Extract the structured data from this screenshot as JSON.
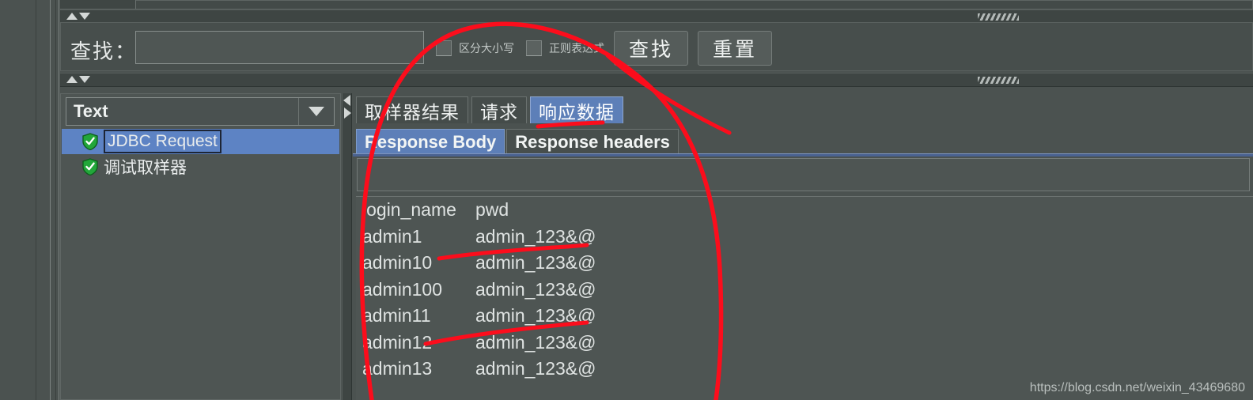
{
  "find_bar": {
    "label": "查找：",
    "input_value": "",
    "input_placeholder": "",
    "checkboxes": [
      {
        "label": "区分大小写",
        "checked": false
      },
      {
        "label": "正则表达式",
        "checked": false
      }
    ],
    "buttons": [
      {
        "label": "查找"
      },
      {
        "label": "重置"
      }
    ]
  },
  "tree_panel": {
    "combo": {
      "selected": "Text",
      "arrow_icon": "chevron-down-icon"
    },
    "items": [
      {
        "label": "JDBC Request",
        "icon": "green-shield-icon",
        "selected": true
      },
      {
        "label": "调试取样器",
        "icon": "green-shield-icon",
        "selected": false
      }
    ]
  },
  "results": {
    "tabs": [
      {
        "label": "取样器结果",
        "active": false
      },
      {
        "label": "请求",
        "active": false
      },
      {
        "label": "响应数据",
        "active": true
      }
    ],
    "subtabs": [
      {
        "label": "Response Body",
        "active": true
      },
      {
        "label": "Response headers",
        "active": false
      }
    ],
    "search_value": "",
    "body": {
      "header": {
        "col1": "login_name",
        "col2": "pwd"
      },
      "rows": [
        {
          "col1": "admin1",
          "col2": "admin_123&@"
        },
        {
          "col1": "admin10",
          "col2": "admin_123&@"
        },
        {
          "col1": "admin100",
          "col2": "admin_123&@"
        },
        {
          "col1": "admin11",
          "col2": "admin_123&@"
        },
        {
          "col1": "admin12",
          "col2": "admin_123&@"
        },
        {
          "col1": "admin13",
          "col2": "admin_123&@"
        }
      ]
    }
  },
  "watermark": "https://blog.csdn.net/weixin_43469680",
  "colors": {
    "selection_blue": "#5d83c4",
    "tab_active_blue": "#5d7fb8",
    "annotation_red": "#fc0d1c",
    "shield_green": "#22a73a",
    "panel_bg": "#4e5553"
  }
}
